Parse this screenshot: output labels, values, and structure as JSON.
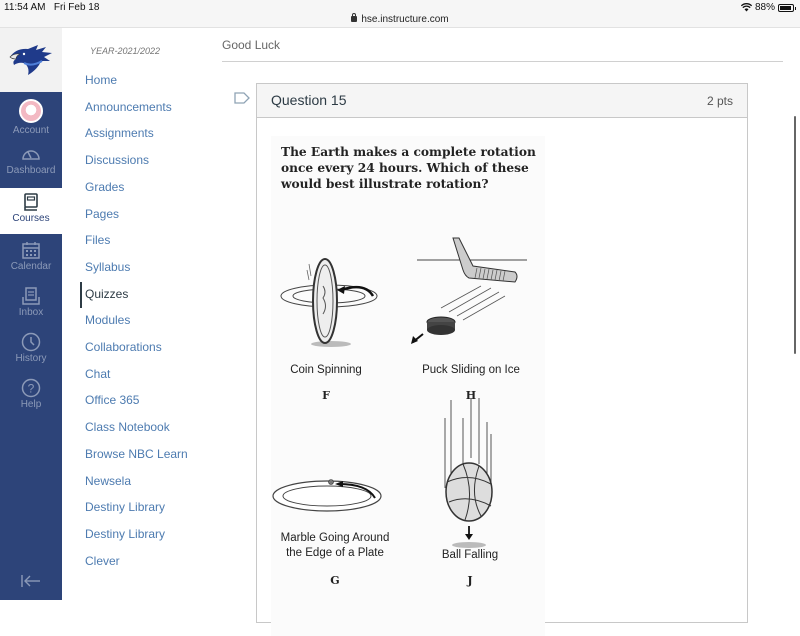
{
  "status_bar": {
    "time": "11:54 AM",
    "date": "Fri Feb 18",
    "url": "hse.instructure.com",
    "battery": "88%",
    "battery_level": 0.88
  },
  "global_nav": {
    "items": [
      {
        "label": "Account",
        "icon": "avatar"
      },
      {
        "label": "Dashboard",
        "icon": "dashboard-icon"
      },
      {
        "label": "Courses",
        "icon": "courses-icon",
        "active": true
      },
      {
        "label": "Calendar",
        "icon": "calendar-icon"
      },
      {
        "label": "Inbox",
        "icon": "inbox-icon"
      },
      {
        "label": "History",
        "icon": "history-icon"
      },
      {
        "label": "Help",
        "icon": "help-icon"
      }
    ],
    "collapse_icon": "collapse-icon"
  },
  "course_nav": {
    "term": "YEAR-2021/2022",
    "items": [
      {
        "label": "Home"
      },
      {
        "label": "Announcements"
      },
      {
        "label": "Assignments"
      },
      {
        "label": "Discussions"
      },
      {
        "label": "Grades"
      },
      {
        "label": "Pages"
      },
      {
        "label": "Files"
      },
      {
        "label": "Syllabus"
      },
      {
        "label": "Quizzes",
        "active": true
      },
      {
        "label": "Modules"
      },
      {
        "label": "Collaborations"
      },
      {
        "label": "Chat"
      },
      {
        "label": "Office 365"
      },
      {
        "label": "Class Notebook"
      },
      {
        "label": "Browse NBC Learn"
      },
      {
        "label": "Newsela"
      },
      {
        "label": "Destiny Library"
      },
      {
        "label": "Destiny Library"
      },
      {
        "label": "Clever"
      }
    ]
  },
  "main": {
    "intro": "Good Luck",
    "question": {
      "title": "Question 15",
      "points": "2 pts",
      "text": "The Earth makes a complete rotation once every 24 hours. Which of these would best illustrate rotation?",
      "options": [
        {
          "letter": "F",
          "caption": "Coin Spinning"
        },
        {
          "letter": "H",
          "caption": "Puck Sliding on Ice"
        },
        {
          "letter": "G",
          "caption": "Marble Going Around the Edge of a Plate"
        },
        {
          "letter": "J",
          "caption": "Ball Falling"
        }
      ]
    }
  },
  "colors": {
    "nav_bg": "#2d4479",
    "link": "#4d7bb0",
    "text": "#2d3b45"
  }
}
